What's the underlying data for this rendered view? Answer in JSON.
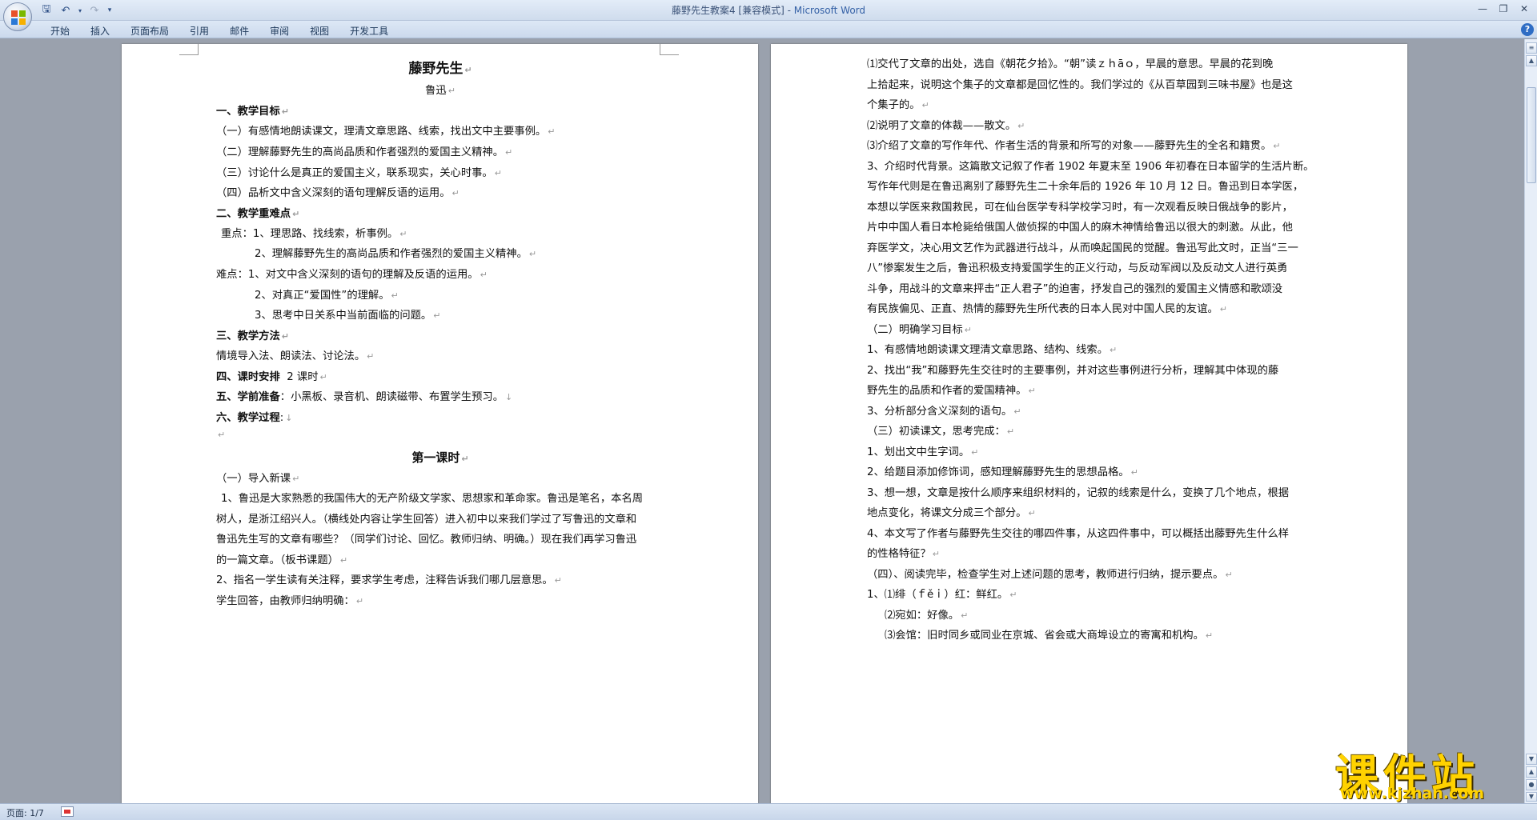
{
  "window": {
    "title": "藤野先生教案4 [兼容模式]",
    "app_name": "Microsoft Word",
    "separator": " - "
  },
  "qat": {
    "save_icon": "save-icon",
    "undo_icon": "undo-icon",
    "redo_icon": "redo-icon",
    "customize_icon": "dropdown-icon"
  },
  "ribbon": {
    "tabs": [
      "开始",
      "插入",
      "页面布局",
      "引用",
      "邮件",
      "审阅",
      "视图",
      "开发工具"
    ]
  },
  "status": {
    "page": "页面: 1/7"
  },
  "watermark": {
    "main": "课件站",
    "url": "www.kjzhan.com"
  },
  "page1": {
    "title": "藤野先生",
    "author": "鲁迅",
    "lines": [
      "一、教学目标",
      "（一）有感情地朗读课文，理清文章思路、线索，找出文中主要事例。",
      "（二）理解藤野先生的高尚品质和作者强烈的爱国主义精神。",
      "（三）讨论什么是真正的爱国主义，联系现实，关心时事。",
      "（四）品析文中含义深刻的语句理解反语的运用。",
      "二、教学重难点",
      "重点：1、理思路、找线索，析事例。",
      "2、理解藤野先生的高尚品质和作者强烈的爱国主义精神。",
      "难点：1、对文中含义深刻的语句的理解及反语的运用。",
      "2、对真正“爱国性”的理解。",
      "3、思考中日关系中当前面临的问题。",
      "三、教学方法",
      "情境导入法、朗读法、讨论法。",
      "四、课时安排",
      "2 课时",
      "五、学前准备",
      "：小黑板、录音机、朗读磁带、布置学生预习。",
      "六、教学过程",
      ":",
      "",
      "第一课时",
      "（一）导入新课",
      "1、鲁迅是大家熟悉的我国伟大的无产阶级文学家、思想家和革命家。鲁迅是笔名，本名周",
      "树人，是浙江绍兴人。（横线处内容让学生回答）进入初中以来我们学过了写鲁迅的文章和",
      "鲁迅先生写的文章有哪些？（同学们讨论、回忆。教师归纳、明确。）现在我们再学习鲁迅",
      "的一篇文章。（板书课题）",
      "2、指名一学生读有关注释，要求学生考虑，注释告诉我们哪几层意思。",
      "学生回答，由教师归纳明确："
    ]
  },
  "page2": {
    "lines": [
      "⑴交代了文章的出处，选自《朝花夕拾》。“朝”读ｚｈāｏ，早晨的意思。早晨的花到晚",
      "上拾起来，说明这个集子的文章都是回忆性的。我们学过的《从百草园到三味书屋》也是这",
      "个集子的。",
      "⑵说明了文章的体裁——散文。",
      "⑶介绍了文章的写作年代、作者生活的背景和所写的对象——藤野先生的全名和籍贯。",
      "3、介绍时代背景。这篇散文记叙了作者 1902 年夏末至 1906 年初春在日本留学的生活片断。",
      "写作年代则是在鲁迅离别了藤野先生二十余年后的 1926 年 10 月 12 日。鲁迅到日本学医，",
      "本想以学医来救国救民，可在仙台医学专科学校学习时，有一次观看反映日俄战争的影片，",
      "片中中国人看日本枪毙给俄国人做侦探的中国人的麻木神情给鲁迅以很大的刺激。从此，他",
      "弃医学文，决心用文艺作为武器进行战斗，从而唤起国民的觉醒。鲁迅写此文时，正当“三一",
      "八”惨案发生之后，鲁迅积极支持爱国学生的正义行动，与反动军阀以及反动文人进行英勇",
      "斗争，用战斗的文章来抨击“正人君子”的迫害，抒发自己的强烈的爱国主义情感和歌颂没",
      "有民族偏见、正直、热情的藤野先生所代表的日本人民对中国人民的友谊。",
      "（二）明确学习目标",
      "1、有感情地朗读课文理清文章思路、结构、线索。",
      "2、找出“我”和藤野先生交往时的主要事例，并对这些事例进行分析，理解其中体现的藤",
      "野先生的品质和作者的爱国精神。",
      "3、分析部分含义深刻的语句。",
      "（三）初读课文，思考完成：",
      "1、划出文中生字词。",
      "2、给题目添加修饰词，感知理解藤野先生的思想品格。",
      "3、想一想，文章是按什么顺序来组织材料的，记叙的线索是什么，变换了几个地点，根据",
      "地点变化，将课文分成三个部分。",
      "4、本文写了作者与藤野先生交往的哪四件事，从这四件事中，可以概括出藤野先生什么样",
      "的性格特征？",
      "（四）、阅读完毕，检查学生对上述问题的思考，教师进行归纳，提示要点。",
      "1、⑴绯（ｆěｉ）红：鲜红。",
      "⑵宛如：好像。",
      "⑶会馆：旧时同乡或同业在京城、省会或大商埠设立的寄寓和机构。"
    ]
  }
}
